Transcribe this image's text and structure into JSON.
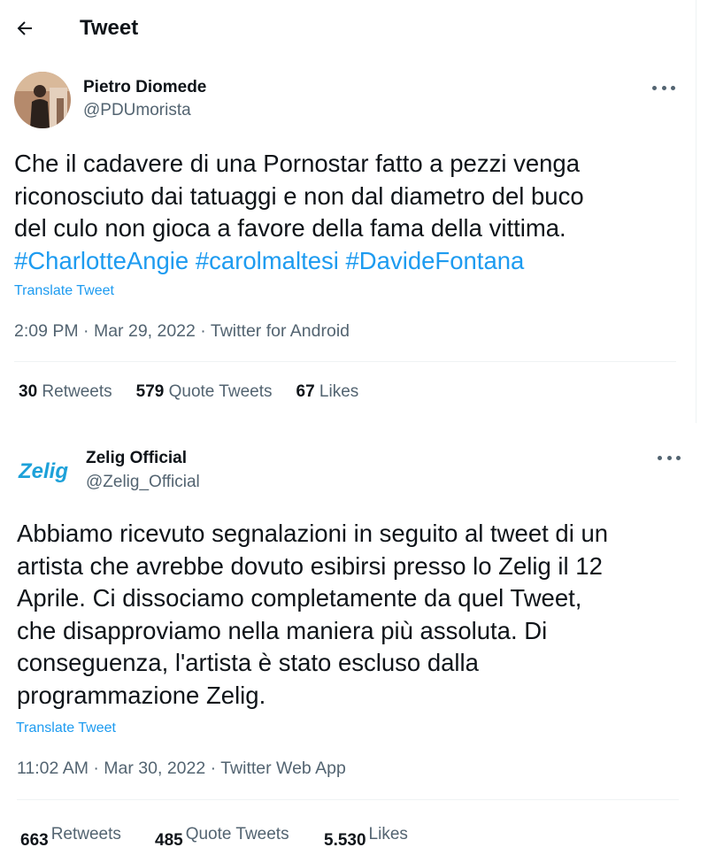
{
  "header": {
    "title": "Tweet"
  },
  "tweet1": {
    "author_name": "Pietro Diomede",
    "handle": "@PDUmorista",
    "text": "Che il cadavere di una Pornostar fatto a pezzi venga\nriconosciuto dai tatuaggi e non dal diametro del buco\ndel culo non gioca a favore della fama della vittima.",
    "hashtags": [
      "#CharlotteAngie",
      "#carolmaltesi",
      "#DavideFontana"
    ],
    "translate_label": "Translate Tweet",
    "time": "2:09 PM",
    "date": "Mar 29, 2022",
    "source": "Twitter for Android",
    "retweets": "30",
    "retweets_label": "Retweets",
    "quote_tweets": "579",
    "quote_tweets_label": "Quote Tweets",
    "likes": "67",
    "likes_label": "Likes"
  },
  "tweet2": {
    "author_name": "Zelig Official",
    "handle": "@Zelig_Official",
    "logo_text": "Zelig",
    "text": "Abbiamo ricevuto segnalazioni in seguito al tweet di un\nartista che avrebbe dovuto esibirsi presso lo Zelig il 12\nAprile. Ci dissociamo completamente da quel Tweet,\nche disapproviamo nella maniera più assoluta. Di\nconseguenza, l'artista è stato escluso dalla\nprogrammazione Zelig.",
    "translate_label": "Translate Tweet",
    "time": "11:02 AM",
    "date": "Mar 30, 2022",
    "source": "Twitter Web App",
    "retweets": "663",
    "retweets_label": "Retweets",
    "quote_tweets": "485",
    "quote_tweets_label": "Quote Tweets",
    "likes": "5.530",
    "likes_label": "Likes"
  },
  "colors": {
    "link": "#1d9bf0",
    "secondary": "#536471",
    "text": "#0f1419",
    "zelig_brand": "#1da1d9"
  },
  "icons": {
    "back": "arrow-left-icon",
    "more": "more-horizontal-icon"
  }
}
